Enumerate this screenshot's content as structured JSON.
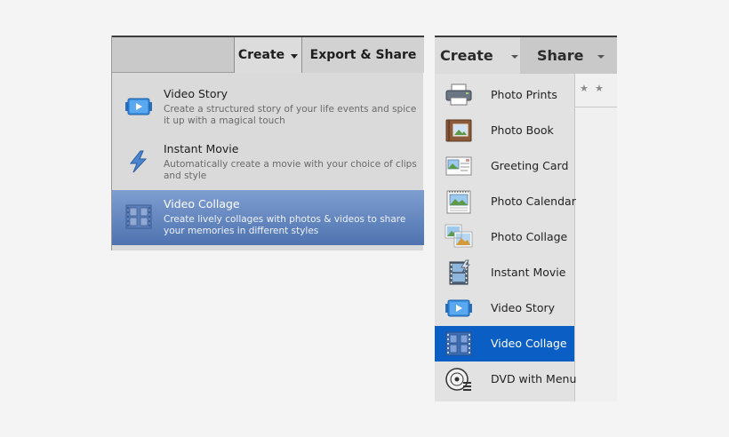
{
  "left_panel": {
    "menubar": {
      "create_label": "Create",
      "export_label": "Export & Share"
    },
    "items": [
      {
        "title": "Video Story",
        "desc": "Create a structured story of your life events and spice it up with a magical touch",
        "icon": "video-story-icon"
      },
      {
        "title": "Instant Movie",
        "desc": "Automatically create a movie with your choice of clips and style",
        "icon": "lightning-icon"
      },
      {
        "title": "Video Collage",
        "desc": "Create lively collages with photos & videos to share your memories in different styles",
        "icon": "video-collage-icon"
      }
    ],
    "selected_index": 2
  },
  "right_panel": {
    "menubar": {
      "create_label": "Create",
      "share_label": "Share"
    },
    "items": [
      {
        "label": "Photo Prints",
        "icon": "printer-icon"
      },
      {
        "label": "Photo Book",
        "icon": "photo-book-icon"
      },
      {
        "label": "Greeting Card",
        "icon": "greeting-card-icon"
      },
      {
        "label": "Photo Calendar",
        "icon": "calendar-icon"
      },
      {
        "label": "Photo Collage",
        "icon": "photo-collage-icon"
      },
      {
        "label": "Instant Movie",
        "icon": "instant-movie-icon"
      },
      {
        "label": "Video Story",
        "icon": "video-story-icon"
      },
      {
        "label": "Video Collage",
        "icon": "video-collage-icon"
      },
      {
        "label": "DVD with Menu",
        "icon": "dvd-icon"
      }
    ],
    "selected_index": 7,
    "stars": [
      "★",
      "★"
    ]
  },
  "colors": {
    "left_selected_top": "#7e9ed0",
    "left_selected_bottom": "#4f73b0",
    "right_selected": "#0b5fc4",
    "video_icon_blue": "#3a8fe0"
  }
}
